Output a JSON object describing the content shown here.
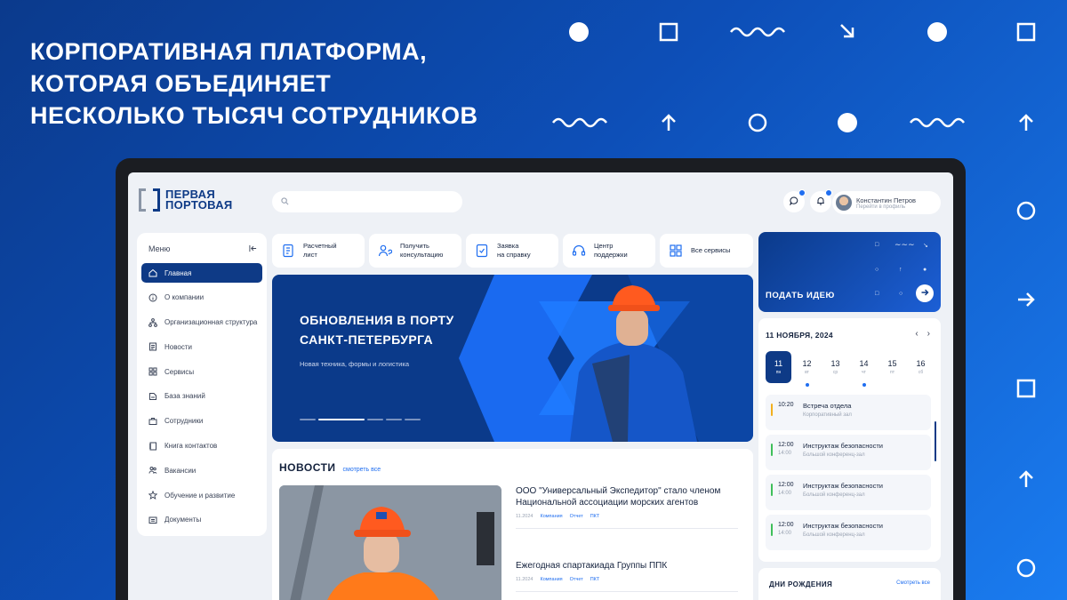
{
  "headline": {
    "line1": "КОРПОРАТИВНАЯ ПЛАТФОРМА,",
    "line2": "КОТОРАЯ ОБЪЕДИНЯЕТ",
    "line3": "НЕСКОЛЬКО ТЫСЯЧ СОТРУДНИКОВ"
  },
  "logo": {
    "line1": "ПЕРВАЯ",
    "line2": "ПОРТОВАЯ"
  },
  "search": {
    "placeholder": ""
  },
  "user": {
    "name": "Константин Петров",
    "subtitle": "Перейти в профиль"
  },
  "sidebar": {
    "title": "Меню",
    "items": [
      {
        "label": "Главная",
        "icon": "home-icon"
      },
      {
        "label": "О компании",
        "icon": "info-icon"
      },
      {
        "label": "Организационная структура",
        "icon": "org-structure-icon"
      },
      {
        "label": "Новости",
        "icon": "news-icon"
      },
      {
        "label": "Сервисы",
        "icon": "services-icon"
      },
      {
        "label": "База знаний",
        "icon": "knowledge-icon"
      },
      {
        "label": "Сотрудники",
        "icon": "employees-icon"
      },
      {
        "label": "Книга контактов",
        "icon": "contacts-icon"
      },
      {
        "label": "Вакансии",
        "icon": "vacancies-icon"
      },
      {
        "label": "Обучение и развитие",
        "icon": "star-icon"
      },
      {
        "label": "Документы",
        "icon": "documents-icon"
      }
    ]
  },
  "quick_actions": [
    {
      "line1": "Расчетный",
      "line2": "лист"
    },
    {
      "line1": "Получить",
      "line2": "консультацию"
    },
    {
      "line1": "Заявка",
      "line2": "на справку"
    },
    {
      "line1": "Центр",
      "line2": "поддержки"
    },
    {
      "line1": "Все сервисы",
      "line2": ""
    }
  ],
  "banner": {
    "title_line1": "ОБНОВЛЕНИЯ В ПОРТУ",
    "title_line2": "САНКТ-ПЕТЕРБУРГА",
    "subtitle": "Новая техника, формы и логистика"
  },
  "news": {
    "title": "НОВОСТИ",
    "see_all": "смотреть все",
    "articles": [
      {
        "title": "ООО \"Универсальный Экспедитор\" стало членом Национальной ассоциации морских агентов",
        "date": "11.2024",
        "tag1": "Компания",
        "tag2": "Отчет",
        "tag3": "ПКТ"
      },
      {
        "title": "Ежегодная спартакиада Группы ППК",
        "date": "11.2024",
        "tag1": "Компания",
        "tag2": "Отчет",
        "tag3": "ПКТ"
      }
    ]
  },
  "idea": {
    "label": "ПОДАТЬ ИДЕЮ"
  },
  "calendar": {
    "title": "11 НОЯБРЯ, 2024",
    "days": [
      {
        "n": "11",
        "w": "пн"
      },
      {
        "n": "12",
        "w": "вт"
      },
      {
        "n": "13",
        "w": "ср"
      },
      {
        "n": "14",
        "w": "чт"
      },
      {
        "n": "15",
        "w": "пт"
      },
      {
        "n": "16",
        "w": "сб"
      }
    ],
    "events": [
      {
        "start": "10:20",
        "end": "",
        "title": "Встреча отдела",
        "place": "Корпоративный зал",
        "color": "#f2b01e"
      },
      {
        "start": "12:00",
        "end": "14:00",
        "title": "Инструктаж безопасности",
        "place": "Большой конференц-зал",
        "color": "#3fbf5a"
      },
      {
        "start": "12:00",
        "end": "14:00",
        "title": "Инструктаж безопасности",
        "place": "Большой конференц-зал",
        "color": "#3fbf5a"
      },
      {
        "start": "12:00",
        "end": "14:00",
        "title": "Инструктаж безопасности",
        "place": "Большой конференц-зал",
        "color": "#3fbf5a"
      }
    ]
  },
  "birthdays": {
    "title": "ДНИ РОЖДЕНИЯ",
    "see_all": "Смотреть все"
  },
  "colors": {
    "primary": "#0e3a86",
    "accent": "#1f6ef0",
    "bg_gradient_start": "#0b3a8c",
    "bg_gradient_end": "#1a7cf0"
  }
}
